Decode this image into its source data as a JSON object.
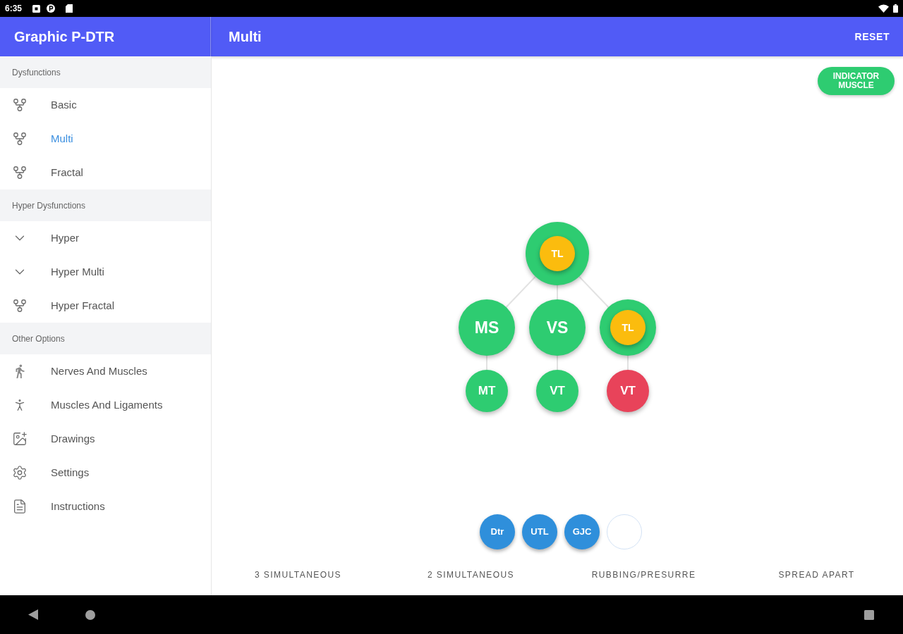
{
  "status_bar": {
    "time": "6:35"
  },
  "app_bar": {
    "title": "Graphic P-DTR",
    "screen_title": "Multi",
    "action": "RESET"
  },
  "sidebar": {
    "sections": [
      {
        "header": "Dysfunctions",
        "items": [
          {
            "label": "Basic",
            "kind": "branch",
            "selected": false
          },
          {
            "label": "Multi",
            "kind": "branch",
            "selected": true
          },
          {
            "label": "Fractal",
            "kind": "branch",
            "selected": false
          }
        ]
      },
      {
        "header": "Hyper Dysfunctions",
        "items": [
          {
            "label": "Hyper",
            "kind": "chevron",
            "selected": false
          },
          {
            "label": "Hyper Multi",
            "kind": "chevron",
            "selected": false
          },
          {
            "label": "Hyper Fractal",
            "kind": "branch",
            "selected": false
          }
        ]
      },
      {
        "header": "Other Options",
        "items": [
          {
            "label": "Nerves And Muscles",
            "kind": "walker",
            "selected": false
          },
          {
            "label": "Muscles And Ligaments",
            "kind": "figure",
            "selected": false
          },
          {
            "label": "Drawings",
            "kind": "gallery",
            "selected": false
          },
          {
            "label": "Settings",
            "kind": "gear",
            "selected": false
          },
          {
            "label": "Instructions",
            "kind": "document",
            "selected": false
          }
        ]
      }
    ]
  },
  "main": {
    "indicator_button": "INDICATOR MUSCLE",
    "tree": {
      "color": "#2ecc71",
      "inner": {
        "label": "TL",
        "color": "#fbbc0e"
      },
      "children": [
        {
          "label": "MS",
          "color": "#2ecc71",
          "children": [
            {
              "label": "MT",
              "color": "#2ecc71"
            }
          ]
        },
        {
          "label": "VS",
          "color": "#2ecc71",
          "children": [
            {
              "label": "VT",
              "color": "#2ecc71"
            }
          ]
        },
        {
          "color": "#2ecc71",
          "inner": {
            "label": "TL",
            "color": "#fbbc0e"
          },
          "children": [
            {
              "label": "VT",
              "color": "#e8435a"
            }
          ]
        }
      ]
    },
    "chips": [
      {
        "kind": "filled",
        "label": "Dtr"
      },
      {
        "kind": "filled",
        "label": "UTL"
      },
      {
        "kind": "filled",
        "label": "GJC"
      },
      {
        "kind": "empty"
      }
    ],
    "actions": [
      "3 SIMULTANEOUS",
      "2 SIMULTANEOUS",
      "RUBBING/PRESURRE",
      "SPREAD APART"
    ]
  }
}
